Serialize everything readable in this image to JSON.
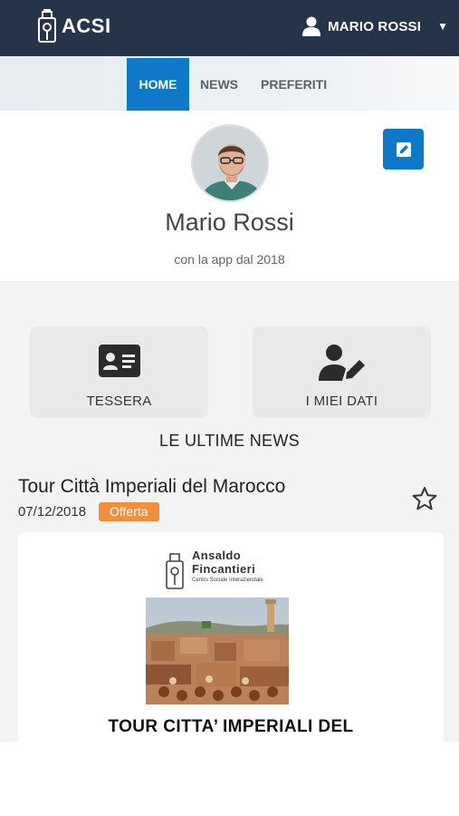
{
  "header": {
    "logo_text": "ACSI",
    "user_name": "MARIO ROSSI",
    "caret": "▼"
  },
  "nav": {
    "tabs": [
      {
        "label": "HOME",
        "active": true
      },
      {
        "label": "NEWS",
        "active": false
      },
      {
        "label": "PREFERITI",
        "active": false
      }
    ]
  },
  "profile": {
    "name": "Mario Rossi",
    "since": "con la app dal 2018"
  },
  "actions": {
    "tessera_label": "TESSERA",
    "dati_label": "I MIEI DATI"
  },
  "news_section": {
    "heading": "LE ULTIME NEWS",
    "item": {
      "title": "Tour Città Imperiali del Marocco",
      "date": "07/12/2018",
      "badge": "Offerta",
      "brand_line1": "Ansaldo",
      "brand_line2": "Fincantieri",
      "brand_line3": "Centro Sociale Interaziendale",
      "card_title": "TOUR CITTA’ IMPERIALI DEL"
    }
  },
  "colors": {
    "header_bg": "#263449",
    "accent": "#0e78c9",
    "badge": "#f28f3b"
  }
}
